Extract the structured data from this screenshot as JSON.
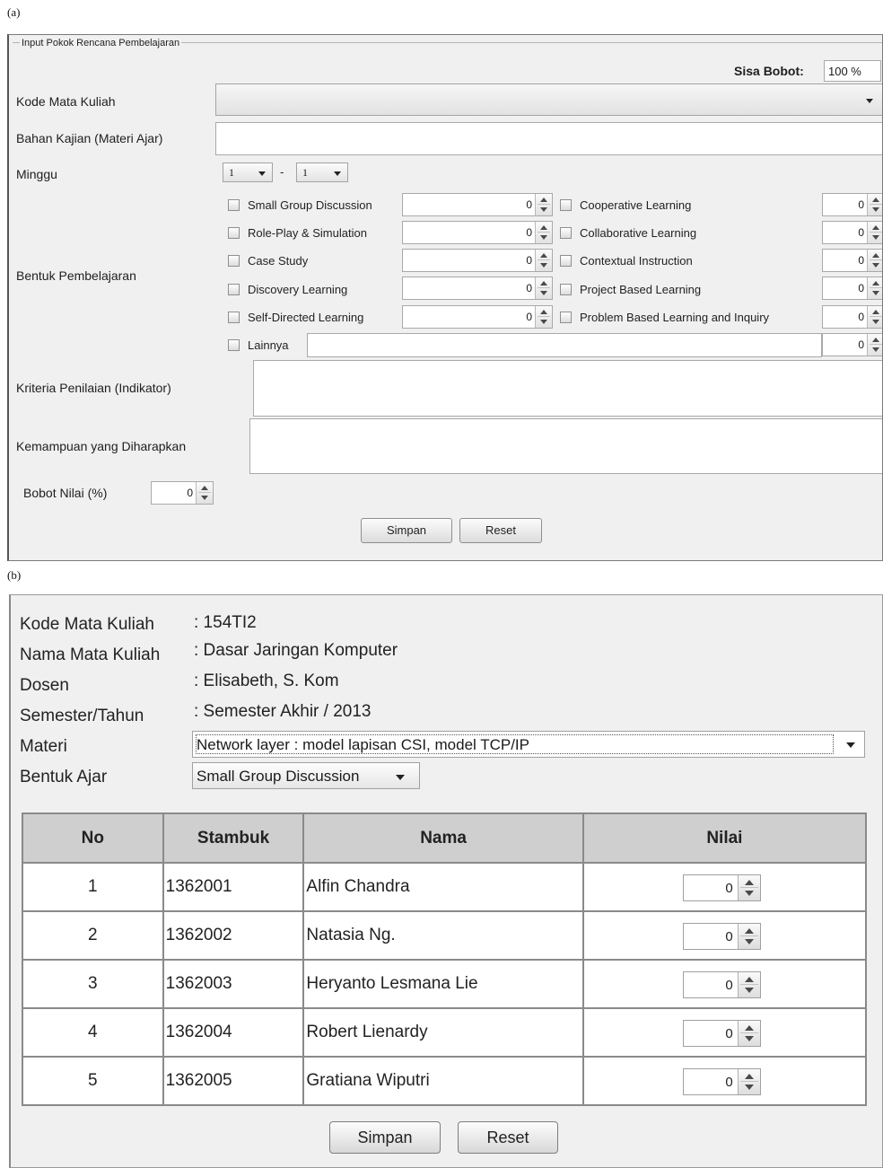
{
  "figure_labels": {
    "a": "(a)",
    "b": "(b)"
  },
  "panel_a": {
    "legend": "Input Pokok Rencana Pembelajaran",
    "sisa_bobot_label": "Sisa Bobot:",
    "sisa_bobot_value": "100 %",
    "kode_label": "Kode Mata Kuliah",
    "kode_value": "",
    "bahan_label": "Bahan Kajian (Materi Ajar)",
    "bahan_value": "",
    "minggu_label": "Minggu",
    "minggu_from": "1",
    "minggu_sep": "-",
    "minggu_to": "1",
    "bentuk_label": "Bentuk Pembelajaran",
    "methods_left": [
      {
        "label": "Small Group Discussion",
        "value": "0"
      },
      {
        "label": "Role-Play & Simulation",
        "value": "0"
      },
      {
        "label": "Case Study",
        "value": "0"
      },
      {
        "label": "Discovery Learning",
        "value": "0"
      },
      {
        "label": "Self-Directed Learning",
        "value": "0"
      }
    ],
    "methods_right": [
      {
        "label": "Cooperative Learning",
        "value": "0"
      },
      {
        "label": "Collaborative Learning",
        "value": "0"
      },
      {
        "label": "Contextual Instruction",
        "value": "0"
      },
      {
        "label": "Project Based Learning",
        "value": "0"
      },
      {
        "label": "Problem Based Learning and Inquiry",
        "value": "0"
      }
    ],
    "lainnya_label": "Lainnya",
    "lainnya_text": "",
    "lainnya_value": "0",
    "kriteria_label": "Kriteria Penilaian (Indikator)",
    "kemampuan_label": "Kemampuan yang Diharapkan",
    "bobot_label": "Bobot Nilai (%)",
    "bobot_value": "0",
    "simpan": "Simpan",
    "reset": "Reset"
  },
  "panel_b": {
    "kode_label": "Kode Mata Kuliah",
    "kode_value": ": 154TI2",
    "nama_label": "Nama Mata Kuliah",
    "nama_value": ": Dasar Jaringan Komputer",
    "dosen_label": "Dosen",
    "dosen_value": ": Elisabeth, S. Kom",
    "semester_label": "Semester/Tahun",
    "semester_value": ": Semester Akhir / 2013",
    "materi_label": "Materi",
    "materi_value": "Network layer : model lapisan CSI, model TCP/IP",
    "bentuk_label": "Bentuk Ajar",
    "bentuk_value": "Small Group Discussion",
    "table": {
      "headers": [
        "No",
        "Stambuk",
        "Nama",
        "Nilai"
      ],
      "rows": [
        {
          "no": "1",
          "stambuk": "1362001",
          "nama": "Alfin Chandra",
          "nilai": "0"
        },
        {
          "no": "2",
          "stambuk": "1362002",
          "nama": "Natasia Ng.",
          "nilai": "0"
        },
        {
          "no": "3",
          "stambuk": "1362003",
          "nama": "Heryanto Lesmana Lie",
          "nilai": "0"
        },
        {
          "no": "4",
          "stambuk": "1362004",
          "nama": "Robert Lienardy",
          "nilai": "0"
        },
        {
          "no": "5",
          "stambuk": "1362005",
          "nama": "Gratiana Wiputri",
          "nilai": "0"
        }
      ]
    },
    "simpan": "Simpan",
    "reset": "Reset"
  }
}
